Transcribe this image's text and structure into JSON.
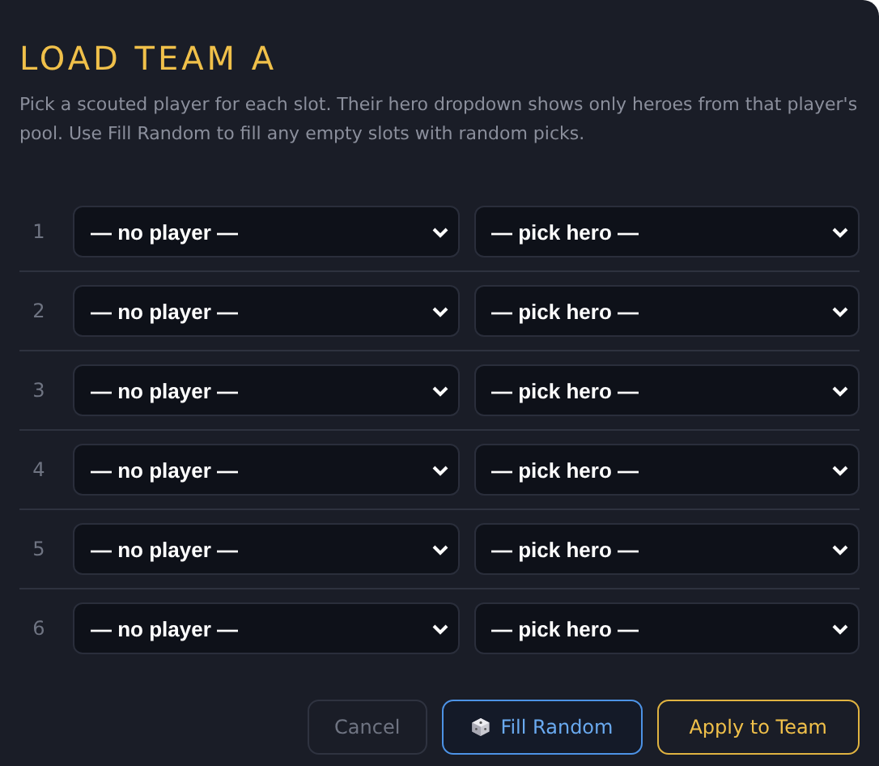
{
  "title": "LOAD TEAM A",
  "description": "Pick a scouted player for each slot. Their hero dropdown shows only heroes from that player's pool. Use Fill Random to fill any empty slots with random picks.",
  "slots": [
    {
      "number": "1",
      "player": "— no player —",
      "hero": "— pick hero —"
    },
    {
      "number": "2",
      "player": "— no player —",
      "hero": "— pick hero —"
    },
    {
      "number": "3",
      "player": "— no player —",
      "hero": "— pick hero —"
    },
    {
      "number": "4",
      "player": "— no player —",
      "hero": "— pick hero —"
    },
    {
      "number": "5",
      "player": "— no player —",
      "hero": "— pick hero —"
    },
    {
      "number": "6",
      "player": "— no player —",
      "hero": "— pick hero —"
    }
  ],
  "buttons": [
    {
      "kind": "cancel",
      "label": "Cancel"
    },
    {
      "kind": "random",
      "label": "Fill Random"
    },
    {
      "kind": "apply",
      "label": "Apply to Team"
    }
  ]
}
